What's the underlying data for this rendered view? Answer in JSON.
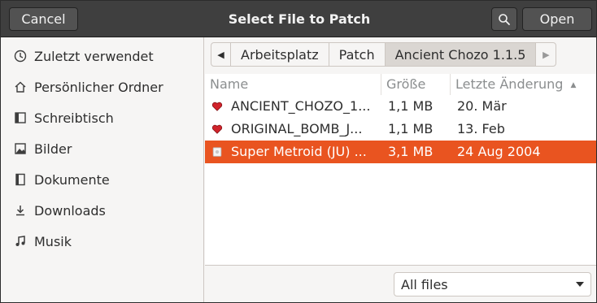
{
  "header": {
    "title": "Select File to Patch",
    "cancel_label": "Cancel",
    "open_label": "Open"
  },
  "sidebar": {
    "items": [
      {
        "label": "Zuletzt verwendet",
        "icon": "recent-icon"
      },
      {
        "label": "Persönlicher Ordner",
        "icon": "home-icon"
      },
      {
        "label": "Schreibtisch",
        "icon": "desktop-icon"
      },
      {
        "label": "Bilder",
        "icon": "pictures-icon"
      },
      {
        "label": "Dokumente",
        "icon": "documents-icon"
      },
      {
        "label": "Downloads",
        "icon": "downloads-icon"
      },
      {
        "label": "Musik",
        "icon": "music-icon"
      }
    ]
  },
  "pathbar": {
    "crumbs": [
      "Arbeitsplatz",
      "Patch",
      "Ancient Chozo 1.1.5"
    ]
  },
  "columns": {
    "name": "Name",
    "size": "Größe",
    "modified": "Letzte Änderung"
  },
  "files": [
    {
      "name": "ANCIENT_CHOZO_1...",
      "size": "1,1 MB",
      "modified": "20. Mär",
      "icon": "heart-icon"
    },
    {
      "name": "ORIGINAL_BOMB_J...",
      "size": "1,1 MB",
      "modified": "13. Feb",
      "icon": "heart-icon"
    },
    {
      "name": "Super Metroid (JU) ...",
      "size": "3,1 MB",
      "modified": "24 Aug 2004",
      "icon": "file-icon"
    }
  ],
  "filter": {
    "selected": "All files"
  },
  "colors": {
    "accent": "#e95420",
    "heart": "#d0232b"
  }
}
